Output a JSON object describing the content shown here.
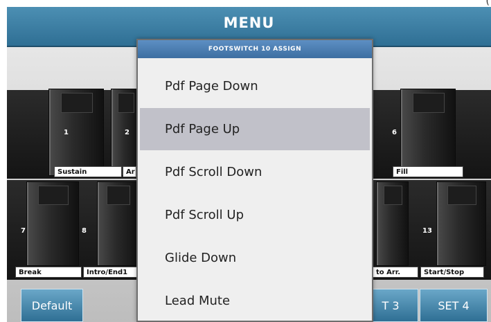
{
  "corner_mark": "(",
  "header": {
    "title": "MENU"
  },
  "pedals": {
    "top": [
      {
        "number": "1",
        "label": "Sustain"
      },
      {
        "number": "2",
        "label": "Ar"
      },
      {
        "number": "6",
        "label": "Fill"
      }
    ],
    "bottom": [
      {
        "number": "7",
        "label": "Break"
      },
      {
        "number": "8",
        "label": "Intro/End1"
      },
      {
        "number": "",
        "label": "to Arr."
      },
      {
        "number": "13",
        "label": "Start/Stop"
      }
    ]
  },
  "buttons": {
    "default": "Default",
    "set3": "T 3",
    "set4": "SET 4"
  },
  "popup": {
    "title": "FOOTSWITCH 10 ASSIGN",
    "items": [
      {
        "label": "Pdf Page Down",
        "selected": false
      },
      {
        "label": "Pdf Page Up",
        "selected": true
      },
      {
        "label": "Pdf Scroll Down",
        "selected": false
      },
      {
        "label": "Pdf Scroll Up",
        "selected": false
      },
      {
        "label": "Glide Down",
        "selected": false
      },
      {
        "label": "Lead Mute",
        "selected": false
      }
    ]
  },
  "colors": {
    "accent": "#3d7aa0",
    "selection": "#c1c1c9"
  }
}
